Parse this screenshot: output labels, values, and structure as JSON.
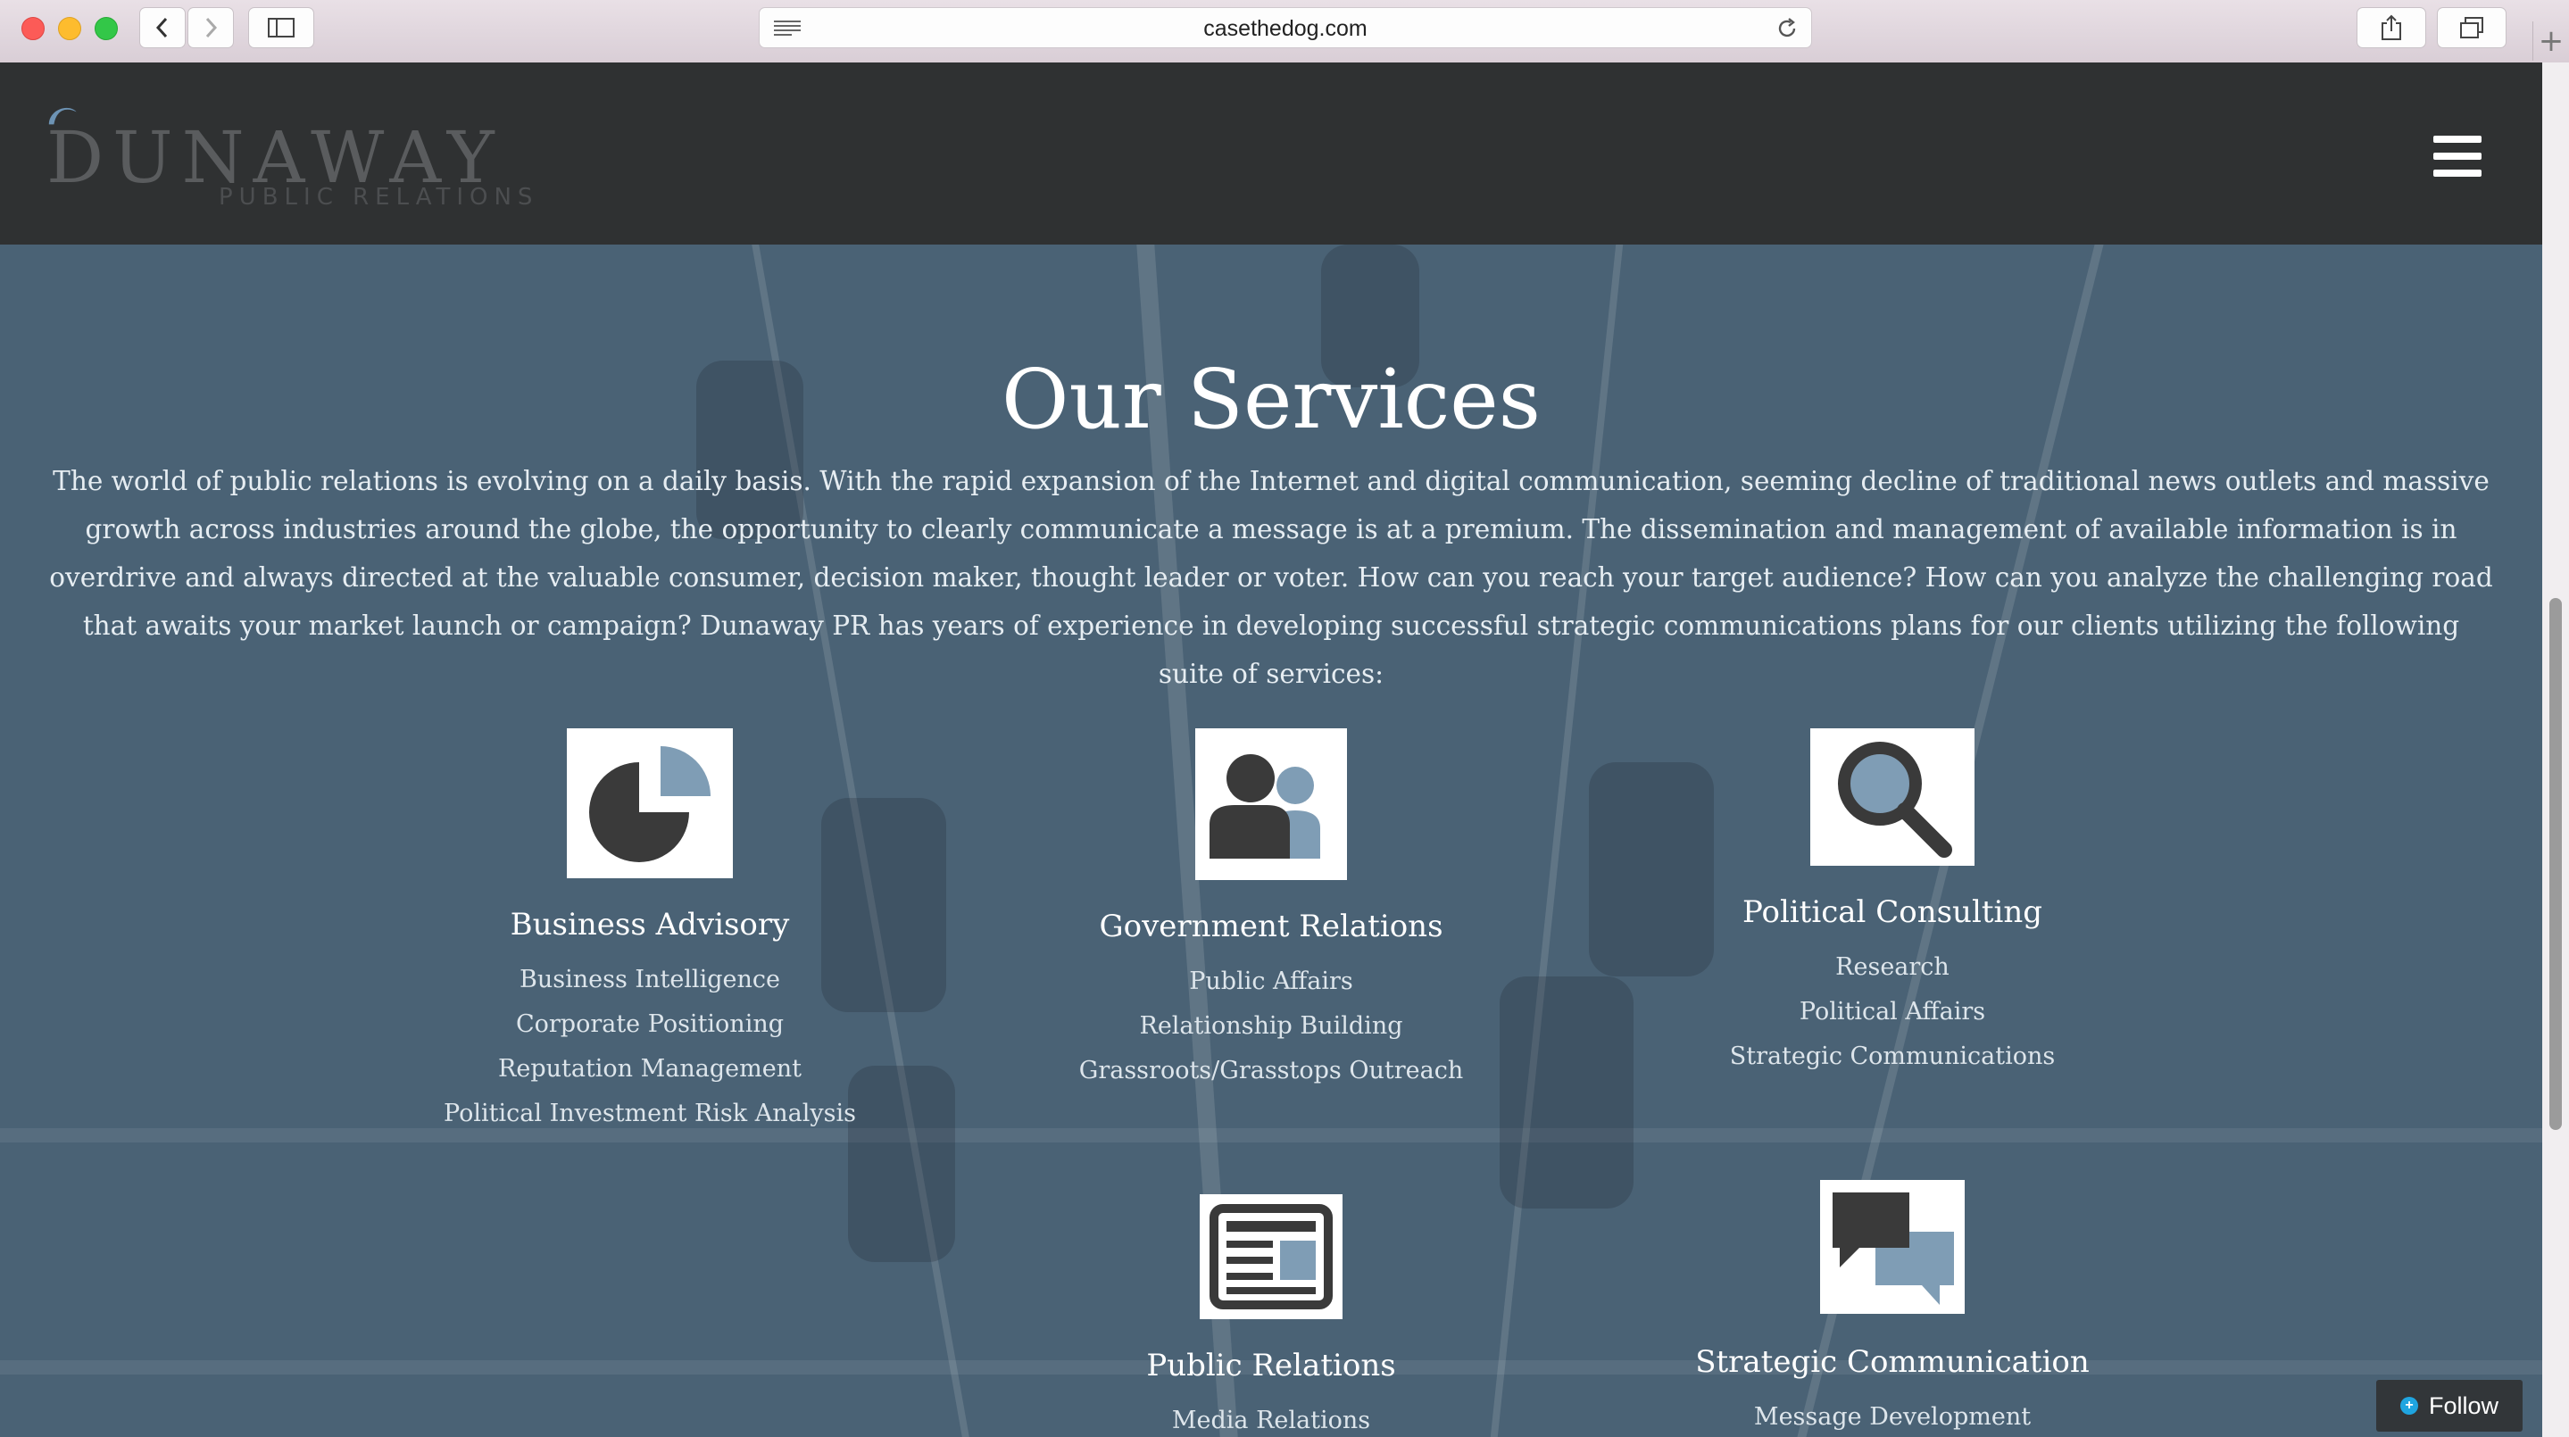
{
  "browser": {
    "url": "casethedog.com"
  },
  "header": {
    "logo_word": "DUNAWAY",
    "logo_sub": "PUBLIC RELATIONS"
  },
  "hero": {
    "title": "Our Services",
    "intro": "The world of public relations is evolving on a daily basis. With the rapid expansion of the Internet and digital communication, seeming decline of traditional news outlets and massive growth across industries around the globe, the opportunity to clearly communicate a message is at a premium. The dissemination and management of available information is in overdrive and always directed at the valuable consumer, decision maker, thought leader or voter. How can you reach your target audience? How can you analyze the challenging road that awaits your market launch or campaign? Dunaway PR has years of experience in developing successful strategic communications plans for our clients utilizing the following suite of services:"
  },
  "services": [
    {
      "title": "Business Advisory",
      "icon": "pie-chart-icon",
      "items": [
        "Business Intelligence",
        "Corporate Positioning",
        "Reputation Management",
        "Political Investment Risk Analysis"
      ]
    },
    {
      "title": "Government Relations",
      "icon": "people-icon",
      "items": [
        "Public Affairs",
        "Relationship Building",
        "Grassroots/Grasstops Outreach"
      ]
    },
    {
      "title": "Political Consulting",
      "icon": "magnifier-icon",
      "items": [
        "Research",
        "Political Affairs",
        "Strategic Communications"
      ]
    },
    {
      "title": "Public Relations",
      "icon": "newspaper-icon",
      "items": [
        "Media Relations"
      ]
    },
    {
      "title": "Strategic Communication",
      "icon": "speech-bubbles-icon",
      "items": [
        "Message Development"
      ]
    }
  ],
  "follow": {
    "label": "Follow"
  },
  "colors": {
    "header_bg": "#2f3132",
    "hero_overlay": "#4a6275",
    "icon_dark": "#3a3a3a",
    "icon_accent": "#7f9db5"
  }
}
